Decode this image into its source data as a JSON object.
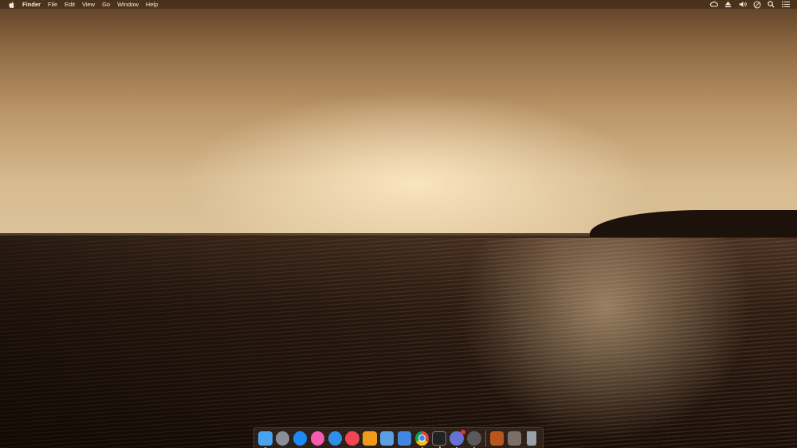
{
  "menubar": {
    "app_name": "Finder",
    "menus": [
      "File",
      "Edit",
      "View",
      "Go",
      "Window",
      "Help"
    ],
    "tray_icons": [
      "creative-cloud-icon",
      "eject-icon",
      "volume-icon",
      "do-not-disturb-icon",
      "search-icon",
      "notification-center-icon"
    ]
  },
  "dock": {
    "apps": [
      {
        "name": "finder",
        "color": "#4aa3f0",
        "running": true
      },
      {
        "name": "launchpad",
        "color": "#8a8f98",
        "running": false
      },
      {
        "name": "app-store",
        "color": "#1e88f5",
        "running": false
      },
      {
        "name": "itunes",
        "color": "#f35cb0",
        "running": false
      },
      {
        "name": "safari",
        "color": "#2f8fe8",
        "running": false
      },
      {
        "name": "news",
        "color": "#f04552",
        "running": false
      },
      {
        "name": "sublime-text",
        "color": "#f09a1c",
        "running": false
      },
      {
        "name": "xcode-helper",
        "color": "#5aa0e0",
        "running": false
      },
      {
        "name": "xcode",
        "color": "#3f86e0",
        "running": false
      },
      {
        "name": "chrome",
        "color": "#e8e8e8",
        "running": true
      },
      {
        "name": "terminal",
        "color": "#222222",
        "running": true
      },
      {
        "name": "discord",
        "color": "#6573d6",
        "running": true,
        "badge": true
      },
      {
        "name": "automator",
        "color": "#5a5a5a",
        "running": true
      }
    ],
    "stacks": [
      {
        "name": "downloads-stack",
        "color": "#b8561e"
      },
      {
        "name": "documents-stack",
        "color": "#7a6f66"
      },
      {
        "name": "trash",
        "color": "#9aa0a8"
      }
    ]
  }
}
